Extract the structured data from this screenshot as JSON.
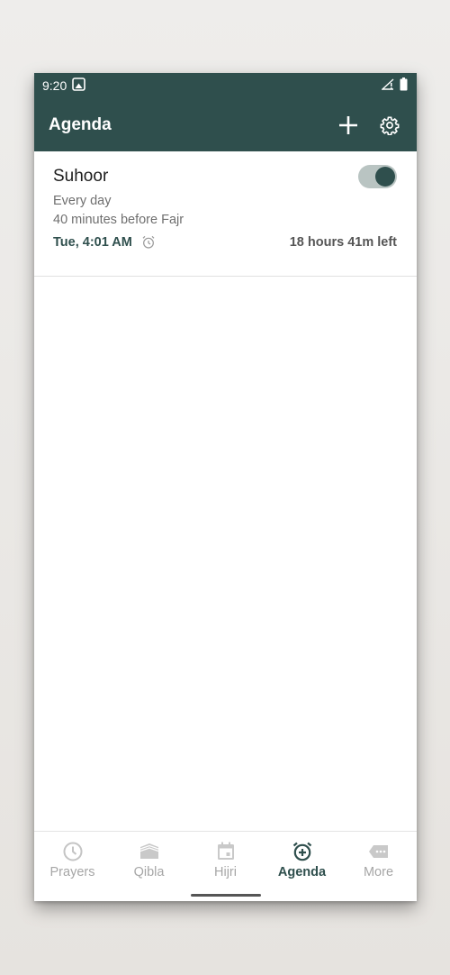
{
  "status_bar": {
    "time": "9:20"
  },
  "toolbar": {
    "title": "Agenda",
    "add_label": "Add",
    "settings_label": "Settings"
  },
  "alarms": [
    {
      "title": "Suhoor",
      "repeat": "Every day",
      "offset": "40 minutes before Fajr",
      "next_time": "Tue, 4:01 AM",
      "remaining": "18 hours 41m left",
      "enabled": true
    }
  ],
  "bottom_nav": {
    "items": [
      {
        "label": "Prayers",
        "icon": "clock-icon",
        "active": false
      },
      {
        "label": "Qibla",
        "icon": "kaaba-icon",
        "active": false
      },
      {
        "label": "Hijri",
        "icon": "calendar-icon",
        "active": false
      },
      {
        "label": "Agenda",
        "icon": "alarm-add-icon",
        "active": true
      },
      {
        "label": "More",
        "icon": "more-tag-icon",
        "active": false
      }
    ]
  },
  "colors": {
    "primary": "#2f4f4d",
    "inactive": "#a6a6a6",
    "toggle_track": "#b9c4c2"
  }
}
